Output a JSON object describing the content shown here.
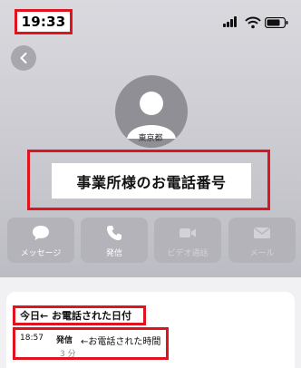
{
  "status_bar": {
    "time": "19:33",
    "icons": [
      "cellular-signal-icon",
      "wifi-icon",
      "battery-icon"
    ]
  },
  "nav": {
    "back_icon": "chevron-left-icon"
  },
  "contact": {
    "location": "東京都",
    "name": "事業所様のお電話番号"
  },
  "actions": [
    {
      "label": "メッセージ",
      "icon": "message-icon",
      "enabled": true
    },
    {
      "label": "発信",
      "icon": "phone-icon",
      "enabled": true
    },
    {
      "label": "ビデオ通話",
      "icon": "video-icon",
      "enabled": false
    },
    {
      "label": "メール",
      "icon": "mail-icon",
      "enabled": false
    }
  ],
  "call_history": {
    "date_label": "今日",
    "date_note": "← お電話された日付",
    "entries": [
      {
        "time": "18:57",
        "type": "発信",
        "note": "←お電話された時間",
        "duration": "3 分"
      }
    ]
  },
  "colors": {
    "highlight": "#e0141e",
    "header_bg": "#cacad0",
    "button_bg": "#b3b3b9"
  }
}
